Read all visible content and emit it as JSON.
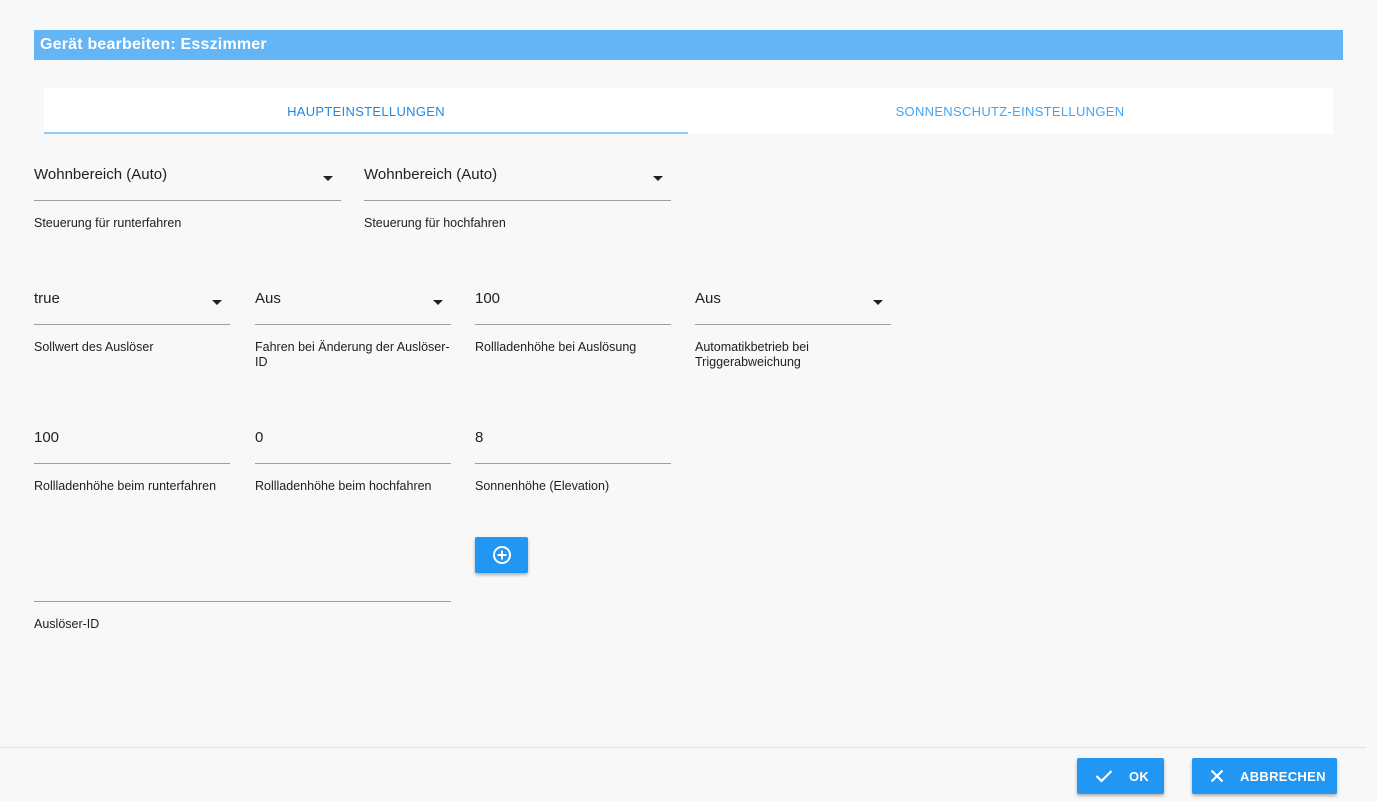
{
  "dialog": {
    "title": "Gerät bearbeiten: Esszimmer"
  },
  "tabs": [
    {
      "label": "HAUPTEINSTELLUNGEN",
      "active": true
    },
    {
      "label": "SONNENSCHUTZ-EINSTELLUNGEN",
      "active": false
    }
  ],
  "fields": {
    "down_control": {
      "value": "Wohnbereich (Auto)",
      "label": "Steuerung für runterfahren"
    },
    "up_control": {
      "value": "Wohnbereich (Auto)",
      "label": "Steuerung für hochfahren"
    },
    "trigger_setpoint": {
      "value": "true",
      "label": "Sollwert des Auslöser"
    },
    "drive_on_trigger_change": {
      "value": "Aus",
      "label": "Fahren bei Änderung der Auslöser-ID"
    },
    "height_on_trigger": {
      "value": "100",
      "label": "Rollladenhöhe bei Auslösung"
    },
    "auto_mode_on_deviation": {
      "value": "Aus",
      "label": "Automatikbetrieb bei Triggerabweichung"
    },
    "height_down": {
      "value": "100",
      "label": "Rollladenhöhe beim runterfahren"
    },
    "height_up": {
      "value": "0",
      "label": "Rollladenhöhe beim hochfahren"
    },
    "sun_elevation": {
      "value": "8",
      "label": "Sonnenhöhe (Elevation)"
    },
    "trigger_id": {
      "value": "",
      "label": "Auslöser-ID"
    }
  },
  "footer": {
    "ok_label": "OK",
    "cancel_label": "ABBRECHEN"
  },
  "colors": {
    "title_bar": "#64b5f6",
    "primary": "#2196f3",
    "tab_active": "#1e88e5",
    "tab_inactive": "#42a5f5"
  },
  "icons": {
    "add": "add-circle-icon",
    "ok": "check-icon",
    "cancel": "close-icon",
    "dropdown": "dropdown-arrow-icon"
  }
}
